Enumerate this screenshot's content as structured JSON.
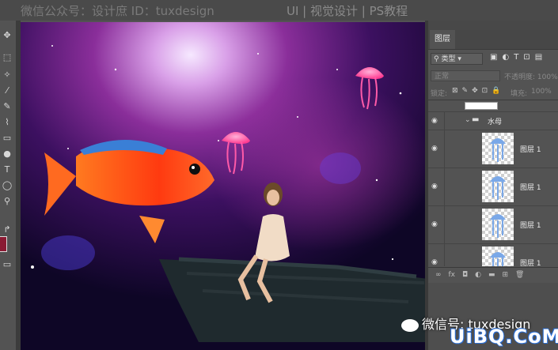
{
  "watermark_top": "微信公众号：设计庶 ID：tuxdesign",
  "page_caption": "UI | 视觉设计 | PS教程",
  "layers_panel": {
    "tab_label": "图层",
    "filter_label": "类型",
    "blend_mode": "正常",
    "opacity_label": "不透明度:",
    "opacity_value": "100%",
    "lock_label": "锁定:",
    "fill_label": "填充:",
    "fill_value": "100%",
    "group_name": "水母",
    "layers": [
      {
        "name": "图层 1"
      },
      {
        "name": "图层 1"
      },
      {
        "name": "图层 1"
      },
      {
        "name": "图层 1"
      }
    ],
    "footer_icons": [
      "link-icon",
      "fx-icon",
      "mask-icon",
      "adjustment-icon",
      "folder-icon",
      "new-layer-icon",
      "trash-icon"
    ]
  },
  "watermark_bottom": "微信号: tuxdesign",
  "site_logo": "UiBQ.CoM",
  "colors": {
    "foreground_swatch": "#8a1a33",
    "panel_bg": "#535353",
    "fish": "#ff5a1a",
    "jellyfish": "#ff4fa0"
  }
}
